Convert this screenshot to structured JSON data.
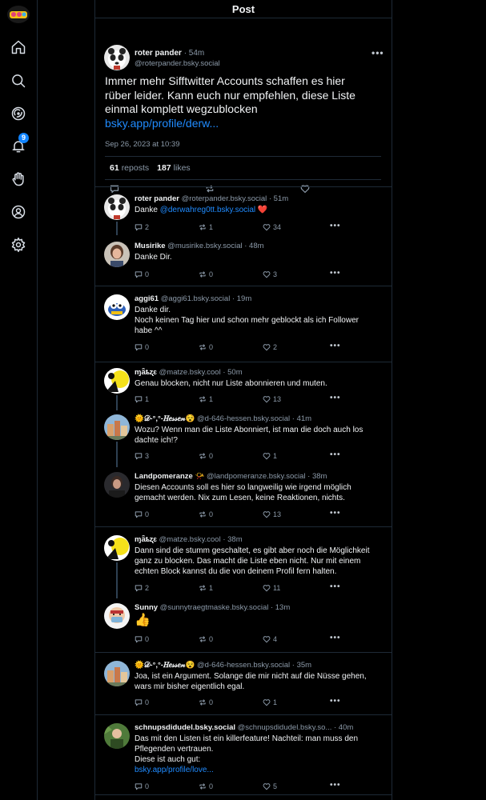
{
  "header": {
    "title": "Post"
  },
  "nav": {
    "notifications_badge": "9"
  },
  "main_post": {
    "author": "roter pander",
    "time": "54m",
    "handle": "@roterpander.bsky.social",
    "text_lines": [
      "Immer mehr Sifftwitter Accounts schaffen es hier",
      "rüber leider. Kann euch nur empfehlen, diese Liste",
      "einmal komplett wegzublocken"
    ],
    "link": "bsky.app/profile/derw...",
    "date": "Sep 26, 2023 at 10:39",
    "reposts": "61",
    "reposts_label": "reposts",
    "likes": "187",
    "likes_label": "likes"
  },
  "replies": [
    {
      "name": "roter pander",
      "handle": "@roterpander.bsky.social",
      "time": "51m",
      "body": [
        "Danke "
      ],
      "mention": "@derwahreg0tt.bsky.social",
      "suffix": " ❤️",
      "replies": "2",
      "reposts": "1",
      "likes": "34",
      "avatar": "panda"
    },
    {
      "name": "Musirike",
      "handle": "@musirike.bsky.social",
      "time": "48m",
      "body": [
        "Danke Dir."
      ],
      "replies": "0",
      "reposts": "0",
      "likes": "3",
      "avatar": "woman"
    },
    {
      "name": "aggi61",
      "handle": "@aggi61.bsky.social",
      "time": "19m",
      "body": [
        "Danke dir.",
        "Noch keinen Tag hier und schon mehr geblockt als ich Follower",
        "habe ^^"
      ],
      "replies": "0",
      "reposts": "0",
      "likes": "2",
      "avatar": "toy"
    },
    {
      "name": "ɱǟȶʐɛ",
      "handle": "@matze.bsky.cool",
      "time": "50m",
      "body": [
        "Genau blocken, nicht nur Liste abonnieren und muten."
      ],
      "replies": "1",
      "reposts": "1",
      "likes": "13",
      "avatar": "yellow"
    },
    {
      "name": "🌞𝒟-°,°-𝐻𝑒𝓈𝓈𝑒𝓃😵",
      "handle": "@d-646-hessen.bsky.social",
      "time": "41m",
      "body": [
        "Wozu? Wenn man die Liste Abonniert, ist man die doch auch los",
        "dachte ich!?"
      ],
      "replies": "3",
      "reposts": "0",
      "likes": "1",
      "avatar": "town"
    },
    {
      "name": "Landpomeranze 📯",
      "handle": "@landpomeranze.bsky.social",
      "time": "38m",
      "body": [
        "Diesen Accounts soll es hier so langweilig wie irgend möglich",
        "gemacht werden. Nix zum Lesen, keine Reaktionen, nichts."
      ],
      "replies": "0",
      "reposts": "0",
      "likes": "13",
      "avatar": "person"
    },
    {
      "name": "ɱǟȶʐɛ",
      "handle": "@matze.bsky.cool",
      "time": "38m",
      "body": [
        "Dann sind die stumm geschaltet, es gibt aber noch die Möglichkeit",
        "ganz zu blocken. Das macht die Liste eben nicht. Nur mit einem",
        "echten Block kannst du die von deinem Profil fern halten."
      ],
      "replies": "2",
      "reposts": "1",
      "likes": "11",
      "avatar": "yellow"
    },
    {
      "name": "Sunny",
      "handle": "@sunnytraegtmaske.bsky.social",
      "time": "13m",
      "body": [
        "👍"
      ],
      "replies": "0",
      "reposts": "0",
      "likes": "4",
      "avatar": "mask"
    },
    {
      "name": "🌞𝒟-°,°-𝐻𝑒𝓈𝓈𝑒𝓃😵",
      "handle": "@d-646-hessen.bsky.social",
      "time": "35m",
      "body": [
        "Joa, ist ein Argument. Solange die mir nicht auf die Nüsse gehen,",
        "wars mir bisher eigentlich egal."
      ],
      "replies": "0",
      "reposts": "0",
      "likes": "1",
      "avatar": "town"
    },
    {
      "name": "schnupsdidudel.bsky.social",
      "handle": "@schnupsdidudel.bsky.so...",
      "time": "40m",
      "body": [
        "Das mit den Listen ist ein killerfeature! Nachteil: man muss den",
        "Pflegenden vertrauen.",
        "Diese ist auch gut:"
      ],
      "link": "bsky.app/profile/love...",
      "replies": "0",
      "reposts": "0",
      "likes": "5",
      "avatar": "green"
    }
  ]
}
